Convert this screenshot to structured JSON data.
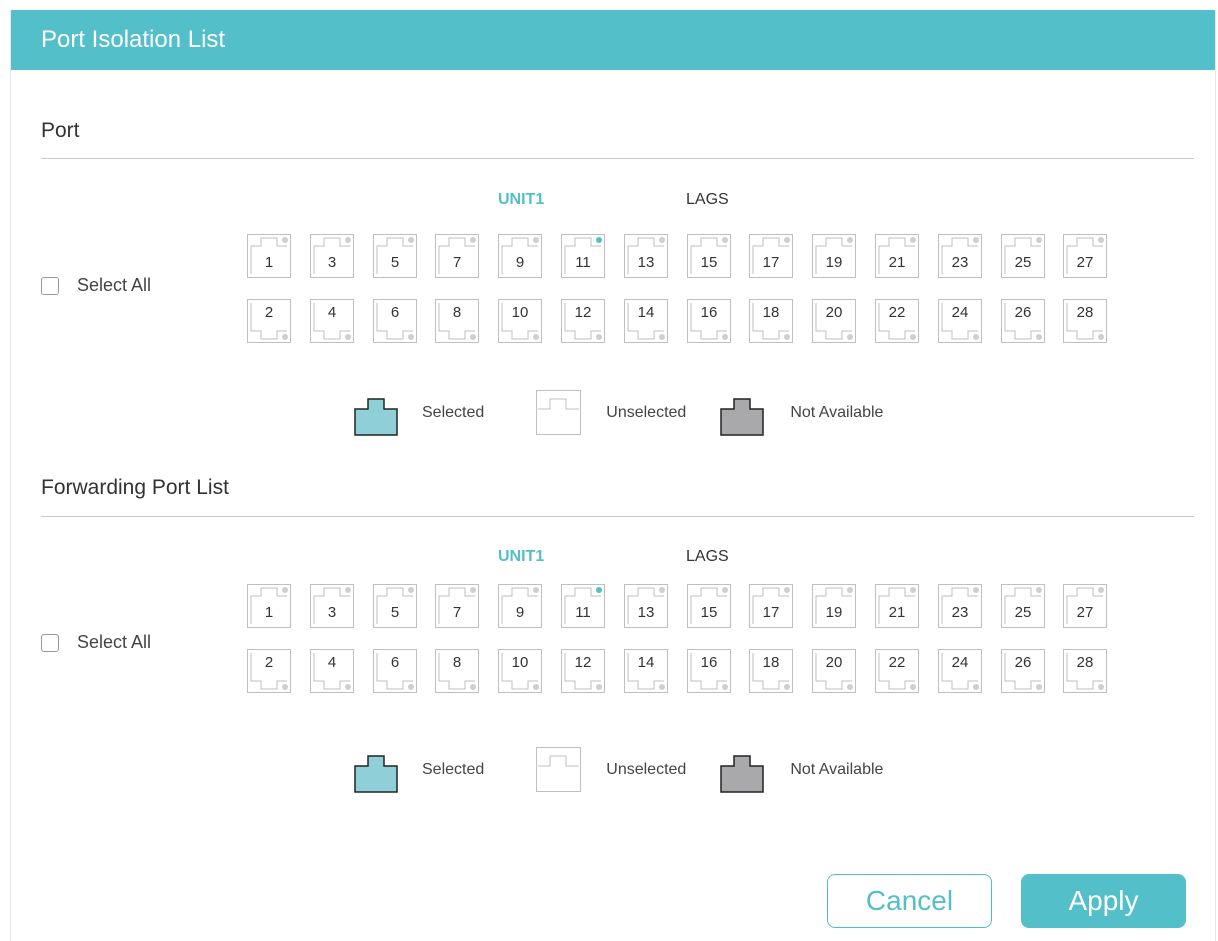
{
  "dialog": {
    "title": "Port Isolation List"
  },
  "sections": [
    {
      "title": "Port",
      "unit_label": "UNIT1",
      "lags_label": "LAGS",
      "select_all_label": "Select All",
      "top_ports": [
        "1",
        "3",
        "5",
        "7",
        "9",
        "11",
        "13",
        "15",
        "17",
        "19",
        "21",
        "23",
        "25",
        "27"
      ],
      "bottom_ports": [
        "2",
        "4",
        "6",
        "8",
        "10",
        "12",
        "14",
        "16",
        "18",
        "20",
        "22",
        "24",
        "26",
        "28"
      ],
      "active_port": "11"
    },
    {
      "title": "Forwarding Port List",
      "unit_label": "UNIT1",
      "lags_label": "LAGS",
      "select_all_label": "Select All",
      "top_ports": [
        "1",
        "3",
        "5",
        "7",
        "9",
        "11",
        "13",
        "15",
        "17",
        "19",
        "21",
        "23",
        "25",
        "27"
      ],
      "bottom_ports": [
        "2",
        "4",
        "6",
        "8",
        "10",
        "12",
        "14",
        "16",
        "18",
        "20",
        "22",
        "24",
        "26",
        "28"
      ],
      "active_port": "11"
    }
  ],
  "legend": {
    "selected": "Selected",
    "unselected": "Unselected",
    "not_available": "Not Available"
  },
  "buttons": {
    "cancel": "Cancel",
    "apply": "Apply"
  },
  "colors": {
    "accent": "#52bfc9",
    "selected_fill": "#8fd0d8",
    "not_available_fill": "#a9a9ab",
    "port_border": "#bfbfbf",
    "indicator_off": "#cfcfcf",
    "indicator_on": "#52bfc9"
  }
}
